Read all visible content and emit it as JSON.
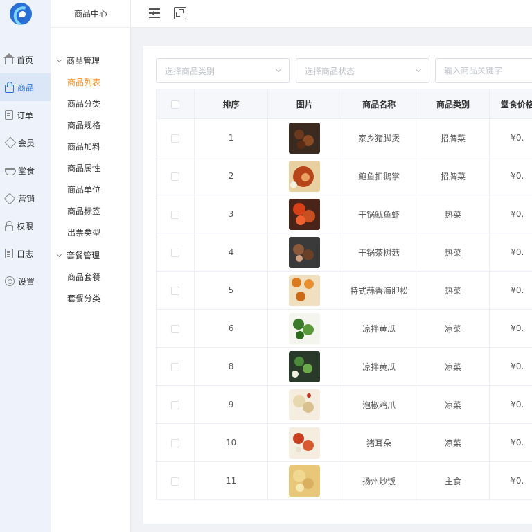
{
  "rail": {
    "items": [
      {
        "label": "首页",
        "icon": "home-icon"
      },
      {
        "label": "商品",
        "icon": "shopping-bag-icon",
        "active": true
      },
      {
        "label": "订单",
        "icon": "order-document-icon"
      },
      {
        "label": "会员",
        "icon": "member-diamond-icon"
      },
      {
        "label": "堂食",
        "icon": "dine-in-bowl-icon"
      },
      {
        "label": "营销",
        "icon": "marketing-tag-icon"
      },
      {
        "label": "权限",
        "icon": "lock-icon"
      },
      {
        "label": "日志",
        "icon": "log-calendar-icon"
      },
      {
        "label": "设置",
        "icon": "settings-gear-icon"
      }
    ]
  },
  "submenu": {
    "title": "商品中心",
    "groups": [
      {
        "label": "商品管理",
        "items": [
          "商品列表",
          "商品分类",
          "商品规格",
          "商品加料",
          "商品属性",
          "商品单位",
          "商品标签",
          "出票类型"
        ]
      },
      {
        "label": "套餐管理",
        "items": [
          "商品套餐",
          "套餐分类"
        ]
      }
    ],
    "active_item": "商品列表"
  },
  "filters": {
    "category_placeholder": "选择商品类别",
    "status_placeholder": "选择商品状态",
    "keyword_placeholder": "输入商品关键字"
  },
  "table": {
    "headers": [
      "",
      "排序",
      "图片",
      "商品名称",
      "商品类别",
      "堂食价格"
    ],
    "rows": [
      {
        "order": "1",
        "name": "家乡猪脚煲",
        "category": "招牌菜",
        "price": "¥0."
      },
      {
        "order": "2",
        "name": "鲍鱼扣鹅掌",
        "category": "招牌菜",
        "price": "¥0."
      },
      {
        "order": "3",
        "name": "干锅鱿鱼虾",
        "category": "热菜",
        "price": "¥0."
      },
      {
        "order": "4",
        "name": "干锅茶树菇",
        "category": "热菜",
        "price": "¥0."
      },
      {
        "order": "5",
        "name": "特式蒜香海胆松",
        "category": "热菜",
        "price": "¥0."
      },
      {
        "order": "6",
        "name": "凉拌黄瓜",
        "category": "凉菜",
        "price": "¥0."
      },
      {
        "order": "8",
        "name": "凉拌黄瓜",
        "category": "凉菜",
        "price": "¥0."
      },
      {
        "order": "9",
        "name": "泡椒鸡爪",
        "category": "凉菜",
        "price": "¥0."
      },
      {
        "order": "10",
        "name": "猪耳朵",
        "category": "凉菜",
        "price": "¥0."
      },
      {
        "order": "11",
        "name": "扬州炒饭",
        "category": "主食",
        "price": "¥0."
      }
    ]
  },
  "colors": {
    "accent": "#2a6fd6",
    "active_submenu": "#f08c1a",
    "rail_bg": "#eef3fb"
  }
}
